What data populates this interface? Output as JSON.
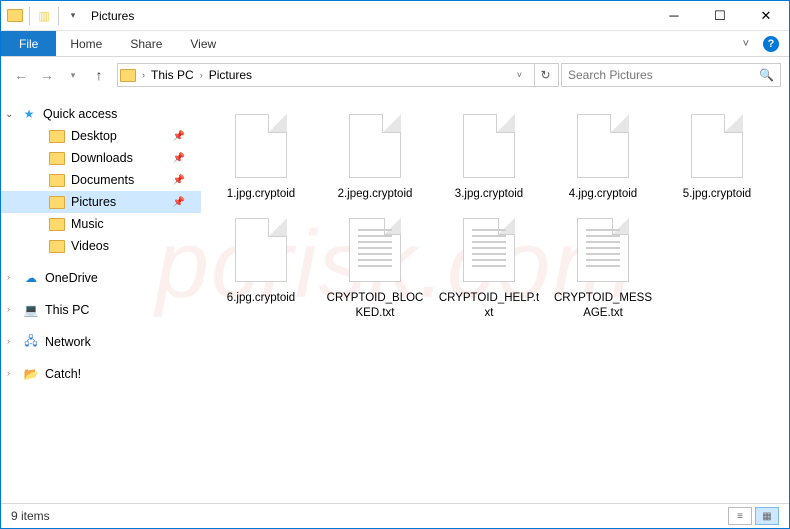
{
  "window": {
    "title": "Pictures"
  },
  "ribbon": {
    "file": "File",
    "tabs": [
      "Home",
      "Share",
      "View"
    ]
  },
  "breadcrumbs": [
    "This PC",
    "Pictures"
  ],
  "search": {
    "placeholder": "Search Pictures"
  },
  "nav": {
    "quick_access": "Quick access",
    "items": [
      {
        "label": "Desktop",
        "pinned": true
      },
      {
        "label": "Downloads",
        "pinned": true
      },
      {
        "label": "Documents",
        "pinned": true
      },
      {
        "label": "Pictures",
        "pinned": true,
        "selected": true
      },
      {
        "label": "Music",
        "pinned": false
      },
      {
        "label": "Videos",
        "pinned": false
      }
    ],
    "roots": [
      {
        "label": "OneDrive",
        "icon": "cloud"
      },
      {
        "label": "This PC",
        "icon": "mon"
      },
      {
        "label": "Network",
        "icon": "net"
      },
      {
        "label": "Catch!",
        "icon": "folder"
      }
    ]
  },
  "files": [
    {
      "name": "1.jpg.cryptoid",
      "type": "blank"
    },
    {
      "name": "2.jpeg.cryptoid",
      "type": "blank"
    },
    {
      "name": "3.jpg.cryptoid",
      "type": "blank"
    },
    {
      "name": "4.jpg.cryptoid",
      "type": "blank"
    },
    {
      "name": "5.jpg.cryptoid",
      "type": "blank"
    },
    {
      "name": "6.jpg.cryptoid",
      "type": "blank"
    },
    {
      "name": "CRYPTOID_BLOCKED.txt",
      "type": "txt"
    },
    {
      "name": "CRYPTOID_HELP.txt",
      "type": "txt"
    },
    {
      "name": "CRYPTOID_MESSAGE.txt",
      "type": "txt"
    }
  ],
  "status": {
    "count_label": "9 items"
  },
  "watermark": "pcrisk.com"
}
